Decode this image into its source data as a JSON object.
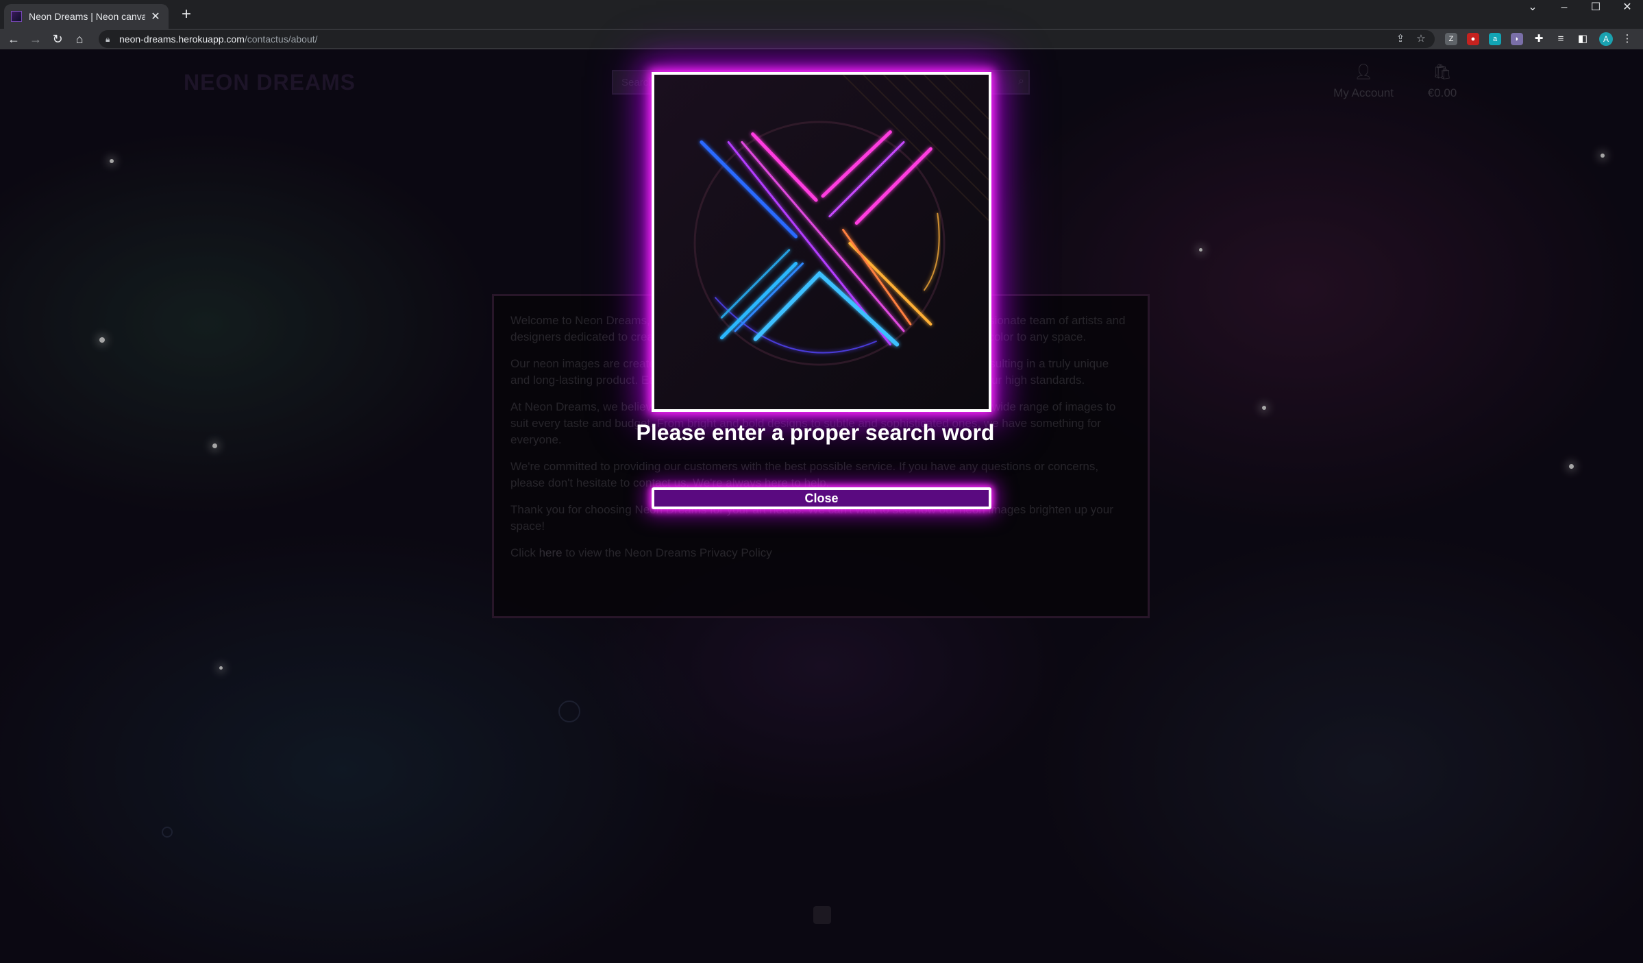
{
  "browser": {
    "tab_title": "Neon Dreams | Neon canvas pri",
    "url_host": "neon-dreams.herokuapp.com",
    "url_path": "/contactus/about/",
    "profile_initial": "A"
  },
  "site": {
    "logo": "NEON DREAMS",
    "search_placeholder": "Search",
    "account_label": "My Account",
    "bag_total": "€0.00"
  },
  "about": {
    "paragraphs": [
      "Welcome to Neon Dreams, your one-stop shop for neon canvas prints. We're a small but passionate team of artists and designers dedicated to creating stunning, eye-catching neon art pieces that will add a pop of color to any space.",
      "Our neon images are created using the latest digital techniques and high-quality materials, resulting in a truly unique and long-lasting product. Each print is carefully checked by our team to ensure that it meets our high standards.",
      "At Neon Dreams, we believe that art should be accessible to everyone. That's why we offer a wide range of images to suit every taste and budget. From bright and bold designs to subtle and sophisticated ones, we have something for everyone.",
      "We're committed to providing our customers with the best possible service. If you have any questions or concerns, please don't hesitate to contact us. We're always here to help.",
      "Thank you for choosing Neon Dreams for your art needs. We can't wait to see how our neon images brighten up your space!"
    ],
    "privacy_prefix": "Click",
    "privacy_link": "here",
    "privacy_suffix": "to view the Neon Dreams Privacy Policy"
  },
  "modal": {
    "message": "Please enter a proper search word",
    "close_label": "Close",
    "glow_color": "#ff2bff"
  }
}
